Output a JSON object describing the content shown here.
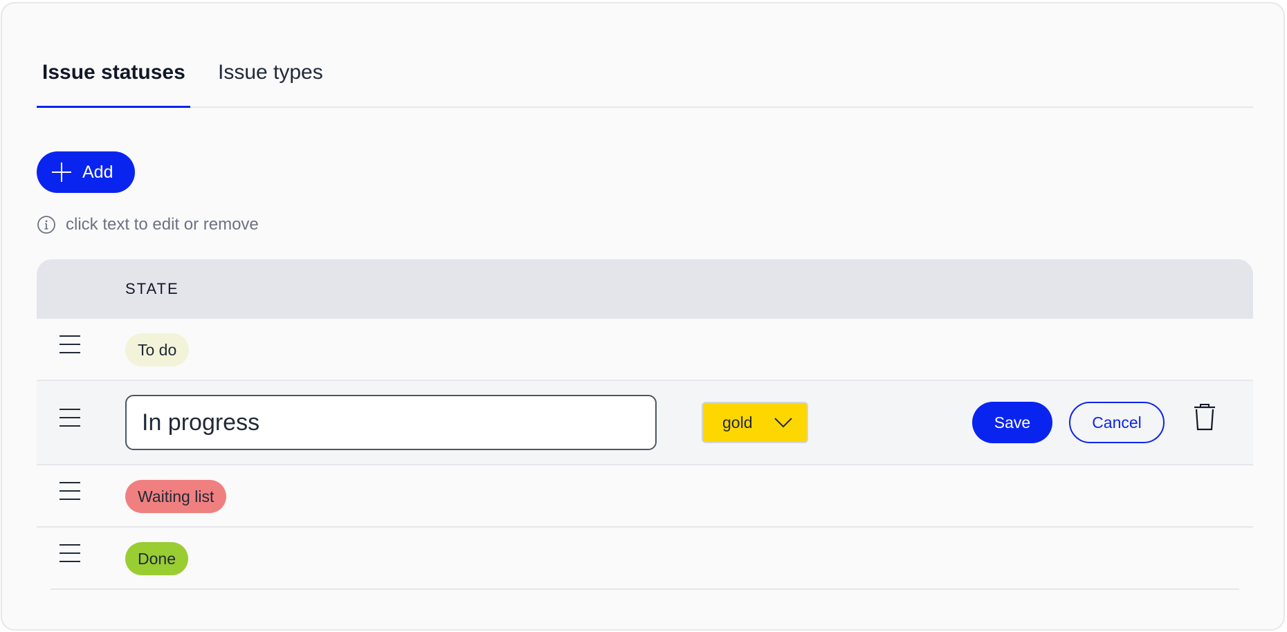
{
  "tabs": [
    {
      "label": "Issue statuses",
      "active": true
    },
    {
      "label": "Issue types",
      "active": false
    }
  ],
  "toolbar": {
    "add_label": "Add"
  },
  "hint": {
    "text": "click text to edit or remove",
    "icon": "info-icon"
  },
  "table": {
    "column_state": "STATE",
    "rows": [
      {
        "label": "To do",
        "color": "#f3f3da"
      },
      {
        "label": "In progress",
        "editing": true
      },
      {
        "label": "Waiting list",
        "color": "#f08080"
      },
      {
        "label": "Done",
        "color": "#9acd32"
      }
    ]
  },
  "editor": {
    "name_value": "In progress",
    "color_value": "gold",
    "color_hex": "#ffd700",
    "save_label": "Save",
    "cancel_label": "Cancel"
  },
  "colors": {
    "accent": "#0a24f0"
  }
}
